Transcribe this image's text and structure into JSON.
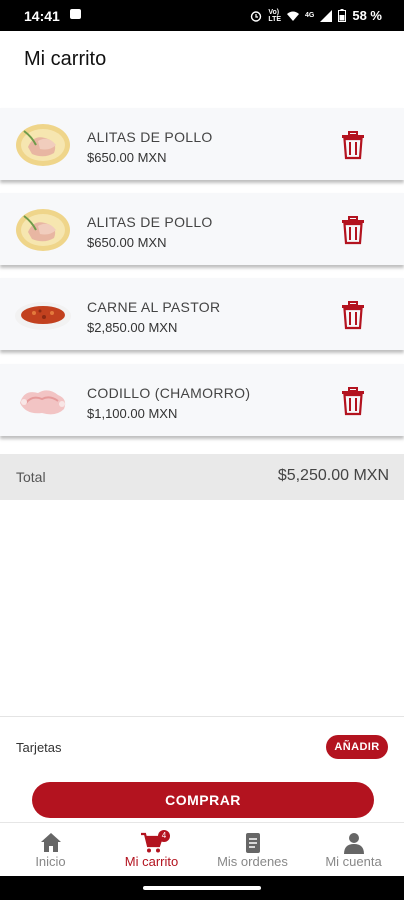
{
  "status_bar": {
    "time": "14:41",
    "network": "4G",
    "battery": "58 %",
    "volte_top": "Vo)",
    "volte_bottom": "LTE"
  },
  "header": {
    "title": "Mi carrito"
  },
  "cart": {
    "items": [
      {
        "name": "ALITAS DE POLLO",
        "price": "$650.00 MXN",
        "image": "chicken-wings"
      },
      {
        "name": "ALITAS DE POLLO",
        "price": "$650.00 MXN",
        "image": "chicken-wings"
      },
      {
        "name": "CARNE AL PASTOR",
        "price": "$2,850.00 MXN",
        "image": "pastor-meat"
      },
      {
        "name": "CODILLO (CHAMORRO)",
        "price": "$1,100.00 MXN",
        "image": "pork-shank"
      }
    ],
    "total_label": "Total",
    "total_value": "$5,250.00 MXN"
  },
  "payment": {
    "cards_label": "Tarjetas",
    "add_label": "AÑADIR",
    "buy_label": "COMPRAR"
  },
  "nav": {
    "items": [
      {
        "label": "Inicio",
        "icon": "home-icon"
      },
      {
        "label": "Mi carrito",
        "icon": "cart-icon",
        "badge": "4"
      },
      {
        "label": "Mis ordenes",
        "icon": "document-icon"
      },
      {
        "label": "Mi cuenta",
        "icon": "person-icon"
      }
    ]
  },
  "colors": {
    "accent": "#b3131f",
    "item_bg": "#f7f8fa",
    "total_bg": "#e9e9e9"
  }
}
